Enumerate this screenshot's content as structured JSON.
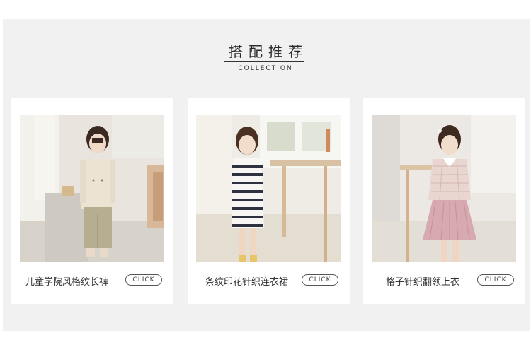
{
  "header": {
    "title": "搭配推荐",
    "subtitle": "COLLECTION"
  },
  "products": [
    {
      "name": "儿童学院风格纹长裤",
      "button_label": "CLICK"
    },
    {
      "name": "条纹印花针织连衣裙",
      "button_label": "CLICK"
    },
    {
      "name": "格子针织翻领上衣",
      "button_label": "CLICK"
    }
  ]
}
